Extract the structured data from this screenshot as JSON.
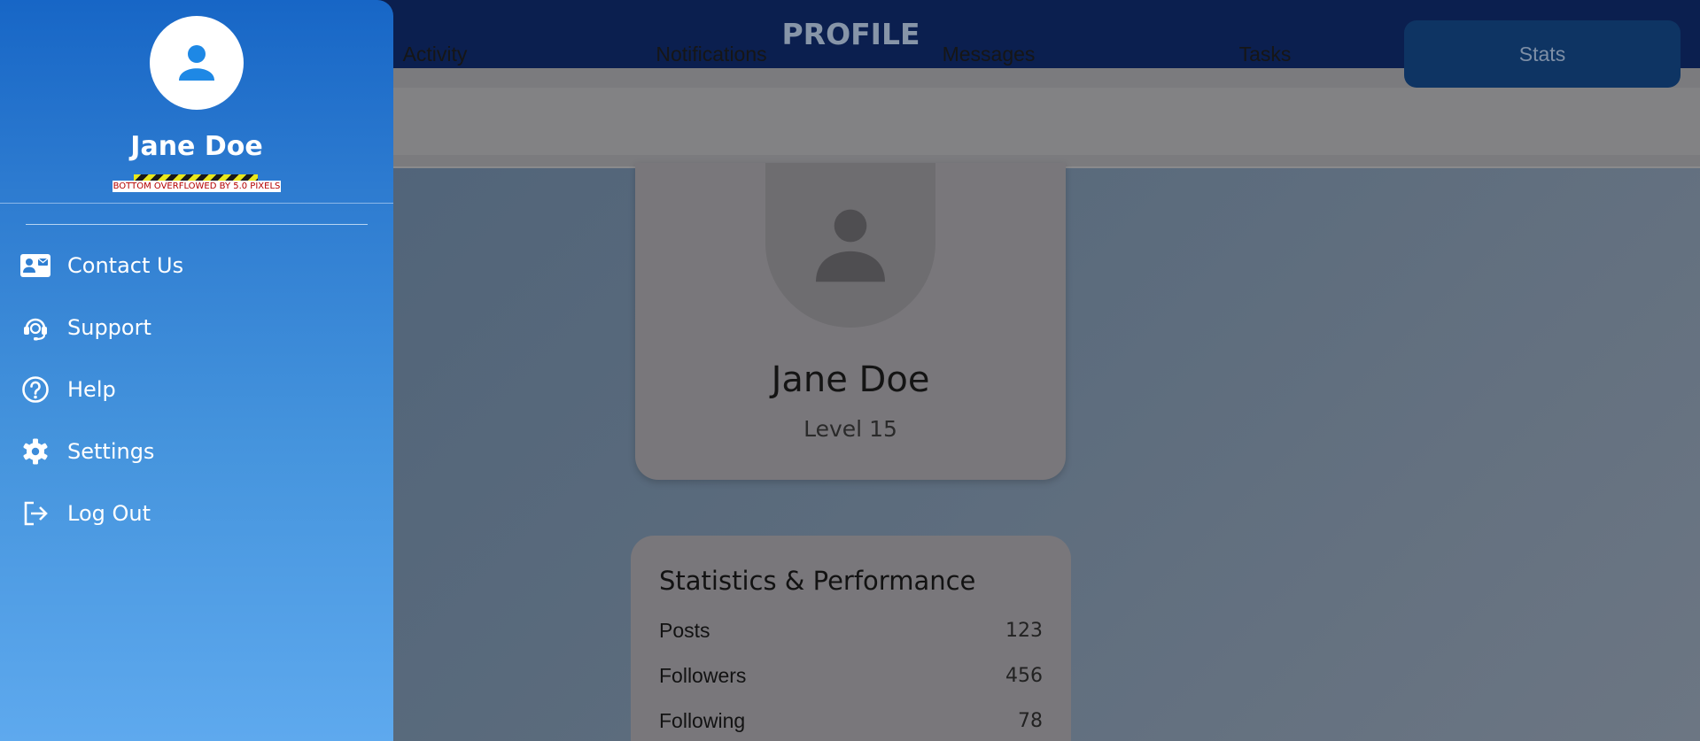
{
  "appbar": {
    "title": "PROFILE"
  },
  "tabs": [
    {
      "label": "Activity",
      "active": false
    },
    {
      "label": "Notifications",
      "active": false
    },
    {
      "label": "Messages",
      "active": false
    },
    {
      "label": "Tasks",
      "active": false
    },
    {
      "label": "Stats",
      "active": true
    }
  ],
  "profile": {
    "name": "Jane Doe",
    "level": "Level 15",
    "avatar_icon": "person-icon"
  },
  "stats": {
    "title": "Statistics & Performance",
    "rows": [
      {
        "label": "Posts",
        "value": "123"
      },
      {
        "label": "Followers",
        "value": "456"
      },
      {
        "label": "Following",
        "value": "78"
      }
    ]
  },
  "drawer": {
    "user_name": "Jane Doe",
    "overflow_warning": "BOTTOM OVERFLOWED BY 5.0 PIXELS",
    "items": [
      {
        "label": "Contact Us",
        "icon": "contact-card-icon"
      },
      {
        "label": "Support",
        "icon": "support-headset-icon"
      },
      {
        "label": "Help",
        "icon": "help-circle-icon"
      },
      {
        "label": "Settings",
        "icon": "gear-icon"
      },
      {
        "label": "Log Out",
        "icon": "logout-icon"
      }
    ]
  },
  "colors": {
    "appbar": "#0b1f4f",
    "active_tab": "#0e3463",
    "drawer_top": "#1766c6",
    "drawer_bottom": "#5ea9ee"
  }
}
